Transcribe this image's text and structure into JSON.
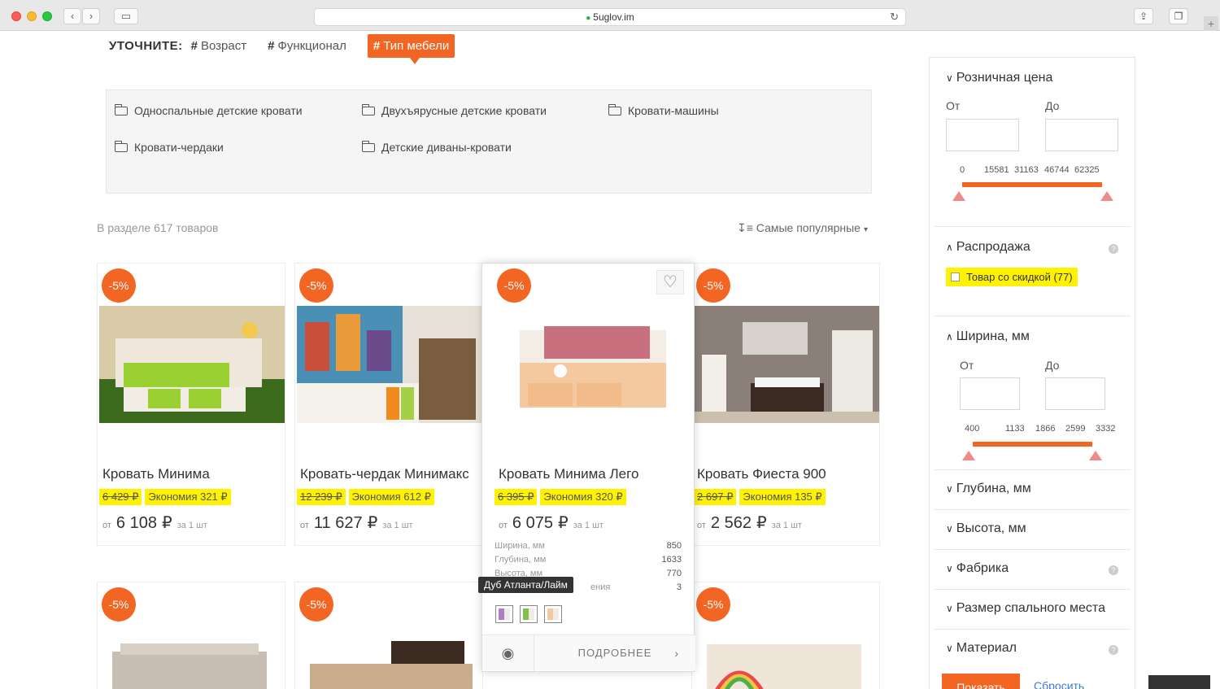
{
  "browser": {
    "url": "5uglov.im"
  },
  "refine": {
    "label": "УТОЧНИТЕ:",
    "tags": [
      {
        "hash": "#",
        "label": "Возраст"
      },
      {
        "hash": "#",
        "label": "Функционал"
      },
      {
        "hash": "#",
        "label": "Тип мебели"
      }
    ]
  },
  "subcategories": [
    "Односпальные детские кровати",
    "Двухъярусные детские кровати",
    "Кровати-машины",
    "Кровати-чердаки",
    "Детские диваны-кровати"
  ],
  "catalog": {
    "count_text": "В разделе 617 товаров",
    "sort_label": "Самые популярные"
  },
  "products": [
    {
      "badge": "-5%",
      "name": "Кровать Минима",
      "old_price": "6 429 ₽",
      "economy": "Экономия 321 ₽",
      "from": "от",
      "price": "6 108",
      "currency": "₽",
      "per": "за 1 шт"
    },
    {
      "badge": "-5%",
      "name": "Кровать-чердак Минимакс",
      "old_price": "12 239 ₽",
      "economy": "Экономия 612 ₽",
      "from": "от",
      "price": "11 627",
      "currency": "₽",
      "per": "за 1 шт"
    },
    {
      "badge": "-5%",
      "name": "Кровать Минима Лего",
      "old_price": "6 395 ₽",
      "economy": "Экономия 320 ₽",
      "from": "от",
      "price": "6 075",
      "currency": "₽",
      "per": "за 1 шт"
    },
    {
      "badge": "-5%",
      "name": "Кровать Фиеста 900",
      "old_price": "2 697 ₽",
      "economy": "Экономия 135 ₽",
      "from": "от",
      "price": "2 562",
      "currency": "₽",
      "per": "за 1 шт"
    }
  ],
  "row2_badges": [
    "-5%",
    "-5%",
    "-5%"
  ],
  "hover_card": {
    "specs": [
      {
        "label": "Ширина, мм",
        "value": "850"
      },
      {
        "label": "Глубина, мм",
        "value": "1633"
      },
      {
        "label": "Высота, мм",
        "value": "770"
      },
      {
        "label": "ения",
        "value": "3"
      }
    ],
    "tooltip": "Дуб Атланта/Лайм",
    "swatch_colors": [
      "#b07cc6",
      "#7ec24a",
      "#f3c9a0"
    ],
    "more_label": "ПОДРОБНЕЕ"
  },
  "sidebar": {
    "price": {
      "title": "Розничная цена",
      "from": "От",
      "to": "До",
      "ticks": [
        "0",
        "15581",
        "31163",
        "46744",
        "62325"
      ]
    },
    "sale": {
      "title": "Распродажа",
      "checkbox_label": "Товар со скидкой (77)"
    },
    "width": {
      "title": "Ширина, мм",
      "from": "От",
      "to": "До",
      "ticks": [
        "400",
        "1133",
        "1866",
        "2599",
        "3332"
      ]
    },
    "collapsed": [
      "Глубина, мм",
      "Высота, мм",
      "Фабрика",
      "Размер спального места",
      "Материал"
    ],
    "show_button": "Показать",
    "reset_link": "Сбросить"
  },
  "colors": {
    "accent": "#f26522",
    "highlight": "#fff200"
  }
}
